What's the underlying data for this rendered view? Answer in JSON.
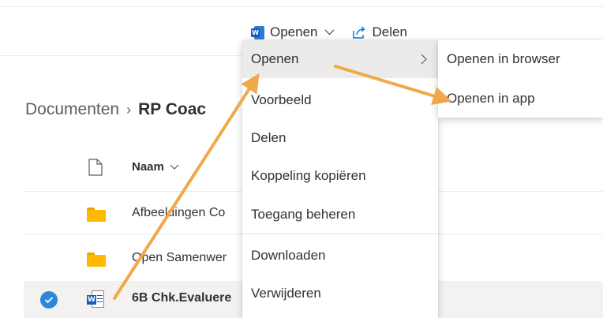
{
  "toolbar": {
    "open_label": "Openen",
    "share_label": "Delen"
  },
  "breadcrumb": {
    "root": "Documenten",
    "separator": "›",
    "current": "RP Coac"
  },
  "file_list": {
    "header_name": "Naam",
    "rows": [
      {
        "name": "Afbeeldingen Co",
        "type": "folder"
      },
      {
        "name": "Open Samenwer",
        "type": "folder"
      },
      {
        "name": "6B Chk.Evaluere",
        "type": "word",
        "selected": true
      }
    ]
  },
  "context_menu": {
    "items": [
      {
        "label": "Openen",
        "has_submenu": true
      },
      {
        "label": "Voorbeeld"
      },
      {
        "label": "Delen"
      },
      {
        "label": "Koppeling kopiëren"
      },
      {
        "label": "Toegang beheren"
      },
      {
        "label": "Downloaden"
      },
      {
        "label": "Verwijderen"
      }
    ]
  },
  "submenu": {
    "items": [
      {
        "label": "Openen in browser"
      },
      {
        "label": "Openen in app"
      }
    ]
  },
  "colors": {
    "accent": "#2b88d8",
    "word_blue": "#185abd",
    "folder": "#ffb900",
    "annotation_arrow": "#f0a94a"
  }
}
